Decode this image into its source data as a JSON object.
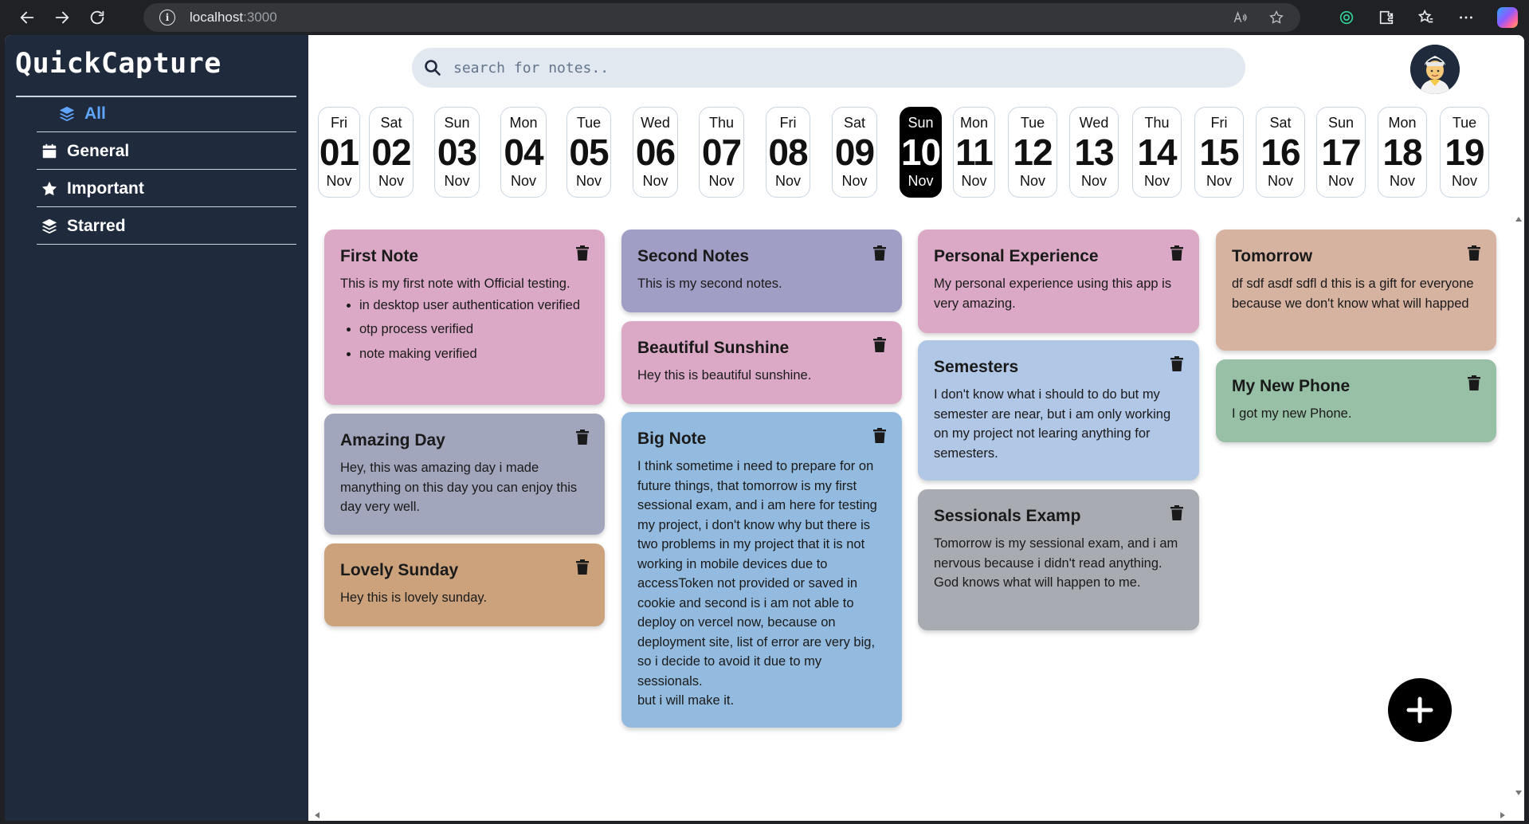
{
  "browser": {
    "url_host": "localhost",
    "url_port": ":3000"
  },
  "sidebar": {
    "brand": "QuickCapture",
    "items": [
      {
        "label": "All",
        "icon": "layers-icon",
        "active": true
      },
      {
        "label": "General",
        "icon": "calendar-icon",
        "active": false
      },
      {
        "label": "Important",
        "icon": "star-icon",
        "active": false
      },
      {
        "label": "Starred",
        "icon": "layers-icon",
        "active": false
      }
    ]
  },
  "search": {
    "placeholder": "search for notes.."
  },
  "days": [
    {
      "name": "Fri",
      "date": "01",
      "month": "Nov"
    },
    {
      "name": "Sat",
      "date": "02",
      "month": "Nov"
    },
    {
      "name": "Sun",
      "date": "03",
      "month": "Nov"
    },
    {
      "name": "Mon",
      "date": "04",
      "month": "Nov"
    },
    {
      "name": "Tue",
      "date": "05",
      "month": "Nov"
    },
    {
      "name": "Wed",
      "date": "06",
      "month": "Nov"
    },
    {
      "name": "Thu",
      "date": "07",
      "month": "Nov"
    },
    {
      "name": "Fri",
      "date": "08",
      "month": "Nov"
    },
    {
      "name": "Sat",
      "date": "09",
      "month": "Nov"
    },
    {
      "name": "Sun",
      "date": "10",
      "month": "Nov",
      "selected": true
    },
    {
      "name": "Mon",
      "date": "11",
      "month": "Nov"
    },
    {
      "name": "Tue",
      "date": "12",
      "month": "Nov"
    },
    {
      "name": "Wed",
      "date": "13",
      "month": "Nov"
    },
    {
      "name": "Thu",
      "date": "14",
      "month": "Nov"
    },
    {
      "name": "Fri",
      "date": "15",
      "month": "Nov"
    },
    {
      "name": "Sat",
      "date": "16",
      "month": "Nov"
    },
    {
      "name": "Sun",
      "date": "17",
      "month": "Nov"
    },
    {
      "name": "Mon",
      "date": "18",
      "month": "Nov"
    },
    {
      "name": "Tue",
      "date": "19",
      "month": "Nov"
    }
  ],
  "notes": {
    "first": {
      "title": "First Note",
      "body": "This is my first note with Official testing.",
      "bullets": [
        "in desktop user authentication verified",
        "otp process verified",
        "note making verified"
      ],
      "color": "#dba9c5"
    },
    "amazing": {
      "title": "Amazing Day",
      "body": "Hey, this was amazing day i made manything on this day you can enjoy this day very well.",
      "color": "#a2a6bc"
    },
    "sunday": {
      "title": "Lovely Sunday",
      "body": "Hey this is lovely sunday.",
      "color": "#cba27c"
    },
    "second": {
      "title": "Second Notes",
      "body": "This is my second notes.",
      "color": "#a09ec5"
    },
    "sunshine": {
      "title": "Beautiful Sunshine",
      "body": "Hey this is beautiful sunshine.",
      "color": "#dba9c5"
    },
    "big": {
      "title": "Big Note",
      "body": "I think sometime i need to prepare for on future things, that tomorrow is my first sessional exam, and i am here for testing my project, i don't know why but there is two problems in my project that it is not working in mobile devices due to accessToken not provided or saved in cookie and second is i am not able to deploy on vercel now, because on deployment site, list of error are very big, so i decide to avoid it due to my sessionals.",
      "body2": "but i will make it.",
      "color": "#93badf"
    },
    "personal": {
      "title": "Personal Experience",
      "body": "My personal experience using this app is very amazing.",
      "color": "#dba9c5"
    },
    "semesters": {
      "title": "Semesters",
      "body": "I don't know what i should to do but my semester are near, but i am only working on my project not learing anything for semesters.",
      "color": "#b0c7e6"
    },
    "sessionals": {
      "title": "Sessionals Examp",
      "body": "Tomorrow is my sessional exam, and i am nervous because i didn't read anything. God knows what will happen to me.",
      "color": "#a9abb3"
    },
    "tomorrow": {
      "title": "Tomorrow",
      "body": "df sdf asdf sdfl d this is a gift for everyone because we don't know what will happed",
      "color": "#d6b2a0"
    },
    "phone": {
      "title": "My New Phone",
      "body": "I got my new Phone.",
      "color": "#97c0a6"
    }
  }
}
